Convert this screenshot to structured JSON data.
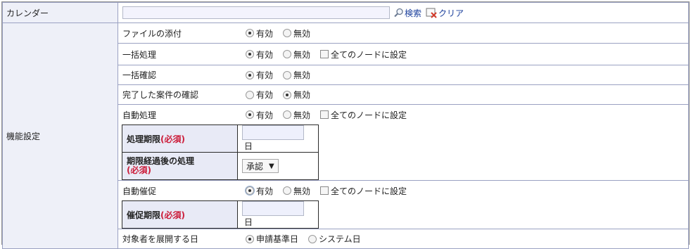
{
  "calendar": {
    "label": "カレンダー",
    "input_value": "",
    "search_label": "検索",
    "clear_label": "クリア"
  },
  "settings": {
    "label": "機能設定",
    "option_enabled": "有効",
    "option_disabled": "無効",
    "all_nodes_label": "全てのノードに設定",
    "attach": {
      "label": "ファイルの添付",
      "selected": "有効"
    },
    "batch": {
      "label": "一括処理",
      "selected": "有効",
      "all_nodes_checked": false
    },
    "batch_confirm": {
      "label": "一括確認",
      "selected": "有効"
    },
    "completed_confirm": {
      "label": "完了した案件の確認",
      "selected": "無効"
    },
    "auto_process": {
      "label": "自動処理",
      "selected": "有効",
      "all_nodes_checked": false,
      "deadline_label": "処理期限",
      "deadline_required": "(必須)",
      "deadline_value": "",
      "deadline_unit": "日",
      "after_label": "期限経過後の処理",
      "after_required": "(必須)",
      "after_value": "承認",
      "after_arrow": "▼"
    },
    "auto_remind": {
      "label": "自動催促",
      "selected": "有効",
      "all_nodes_checked": false,
      "deadline_label": "催促期限",
      "deadline_required": "(必須)",
      "deadline_value": "",
      "deadline_unit": "日"
    },
    "expand_date": {
      "label": "対象者を展開する日",
      "option_apply": "申請基準日",
      "option_system": "システム日",
      "selected": "申請基準日"
    }
  }
}
